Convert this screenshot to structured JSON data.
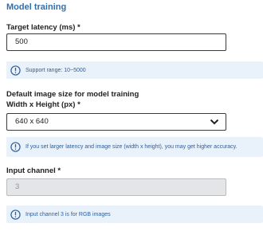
{
  "section": {
    "title": "Model training"
  },
  "latency": {
    "label": "Target latency (ms) *",
    "value": "500",
    "info": "Support range: 10~5000"
  },
  "image_size": {
    "heading": "Default image size for model training",
    "label": "Width x Height (px) *",
    "selected": "640 x 640",
    "info": "If you set larger latency and image size (width x height), you may get higher accuracy."
  },
  "channel": {
    "label": "Input channel *",
    "value": "3",
    "info": "Input channel 3 is for RGB images"
  },
  "icons": {
    "info": "info-circle-icon",
    "dropdown": "chevron-down-icon"
  },
  "colors": {
    "accent": "#2e6fb0",
    "info_bg": "#e9f1fb",
    "info_text": "#2f5f97"
  }
}
